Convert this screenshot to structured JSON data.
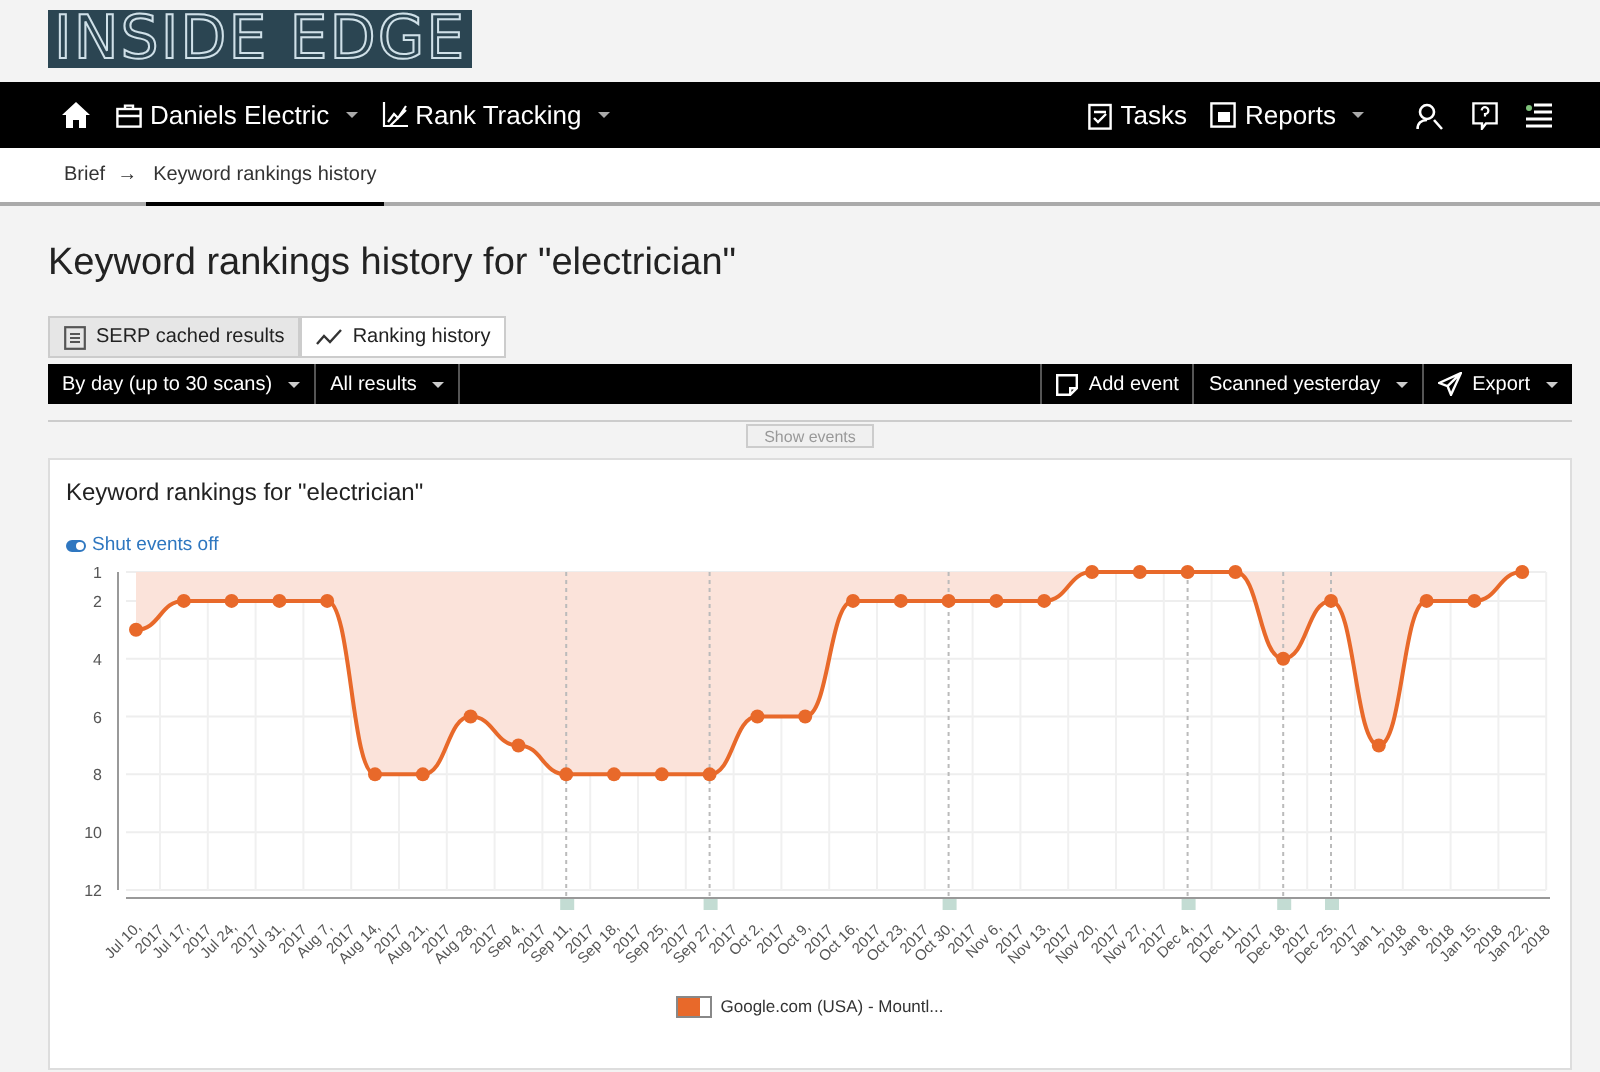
{
  "logo": "INSIDE EDGE",
  "nav": {
    "left": [
      {
        "label": "Daniels Electric",
        "dropdown": true
      },
      {
        "label": "Rank Tracking",
        "dropdown": true
      }
    ],
    "right": [
      {
        "label": "Tasks",
        "dropdown": false
      },
      {
        "label": "Reports",
        "dropdown": true
      }
    ]
  },
  "breadcrumb": {
    "separator": "→",
    "items": [
      {
        "label": "Brief",
        "selected": false
      },
      {
        "label": "Keyword rankings history",
        "selected": true
      }
    ]
  },
  "title": "Keyword rankings history for \"electrician\"",
  "view_tabs": [
    {
      "label": "SERP cached results",
      "selected": false
    },
    {
      "label": "Ranking history",
      "selected": true
    }
  ],
  "toolbar": {
    "left": [
      {
        "label": "By day (up to 30 scans)",
        "dropdown": true
      },
      {
        "label": "All results",
        "dropdown": true
      }
    ],
    "right": [
      {
        "label": "Add event",
        "dropdown": false
      },
      {
        "label": "Scanned yesterday",
        "dropdown": true
      },
      {
        "label": "Export",
        "dropdown": true
      }
    ]
  },
  "show_events": {
    "label": "Show events",
    "disabled": true
  },
  "card": {
    "title": "Keyword rankings for \"electrician\"",
    "toggle": {
      "label": "Shut events off",
      "on": true
    },
    "chart_data": {
      "type": "area",
      "categories": [
        "Jul 10, 2017",
        "Jul 17, 2017",
        "Jul 24, 2017",
        "Jul 31, 2017",
        "Aug 7, 2017",
        "Aug 14, 2017",
        "Aug 21, 2017",
        "Aug 28, 2017",
        "Sep 4, 2017",
        "Sep 11, 2017",
        "Sep 18, 2017",
        "Sep 25, 2017",
        "Sep 27, 2017",
        "Oct 2, 2017",
        "Oct 9, 2017",
        "Oct 16, 2017",
        "Oct 23, 2017",
        "Oct 30, 2017",
        "Nov 6, 2017",
        "Nov 13, 2017",
        "Nov 20, 2017",
        "Nov 27, 2017",
        "Dec 4, 2017",
        "Dec 11, 2017",
        "Dec 18, 2017",
        "Dec 25, 2017",
        "Jan 1, 2018",
        "Jan 8, 2018",
        "Jan 15, 2018",
        "Jan 22, 2018"
      ],
      "series": [
        {
          "name": "Google.com (USA) - Mountl...",
          "color": "#e8692a",
          "values": [
            3,
            2,
            2,
            2,
            2,
            8,
            8,
            6,
            7,
            8,
            8,
            8,
            8,
            6,
            6,
            2,
            2,
            2,
            2,
            2,
            1,
            1,
            1,
            1,
            4,
            2,
            7,
            2,
            2,
            1
          ]
        }
      ],
      "ylim": [
        12,
        1
      ],
      "yticks": [
        1,
        2,
        4,
        6,
        8,
        10,
        12
      ],
      "grid": true,
      "annotations": [
        {
          "x": "Sep 11, 2017"
        },
        {
          "x": "Sep 27, 2017"
        },
        {
          "x": "Oct 30, 2017"
        },
        {
          "x": "Dec 4, 2017"
        },
        {
          "x": "Dec 18, 2017"
        },
        {
          "x": "Dec 25, 2017"
        }
      ]
    }
  }
}
